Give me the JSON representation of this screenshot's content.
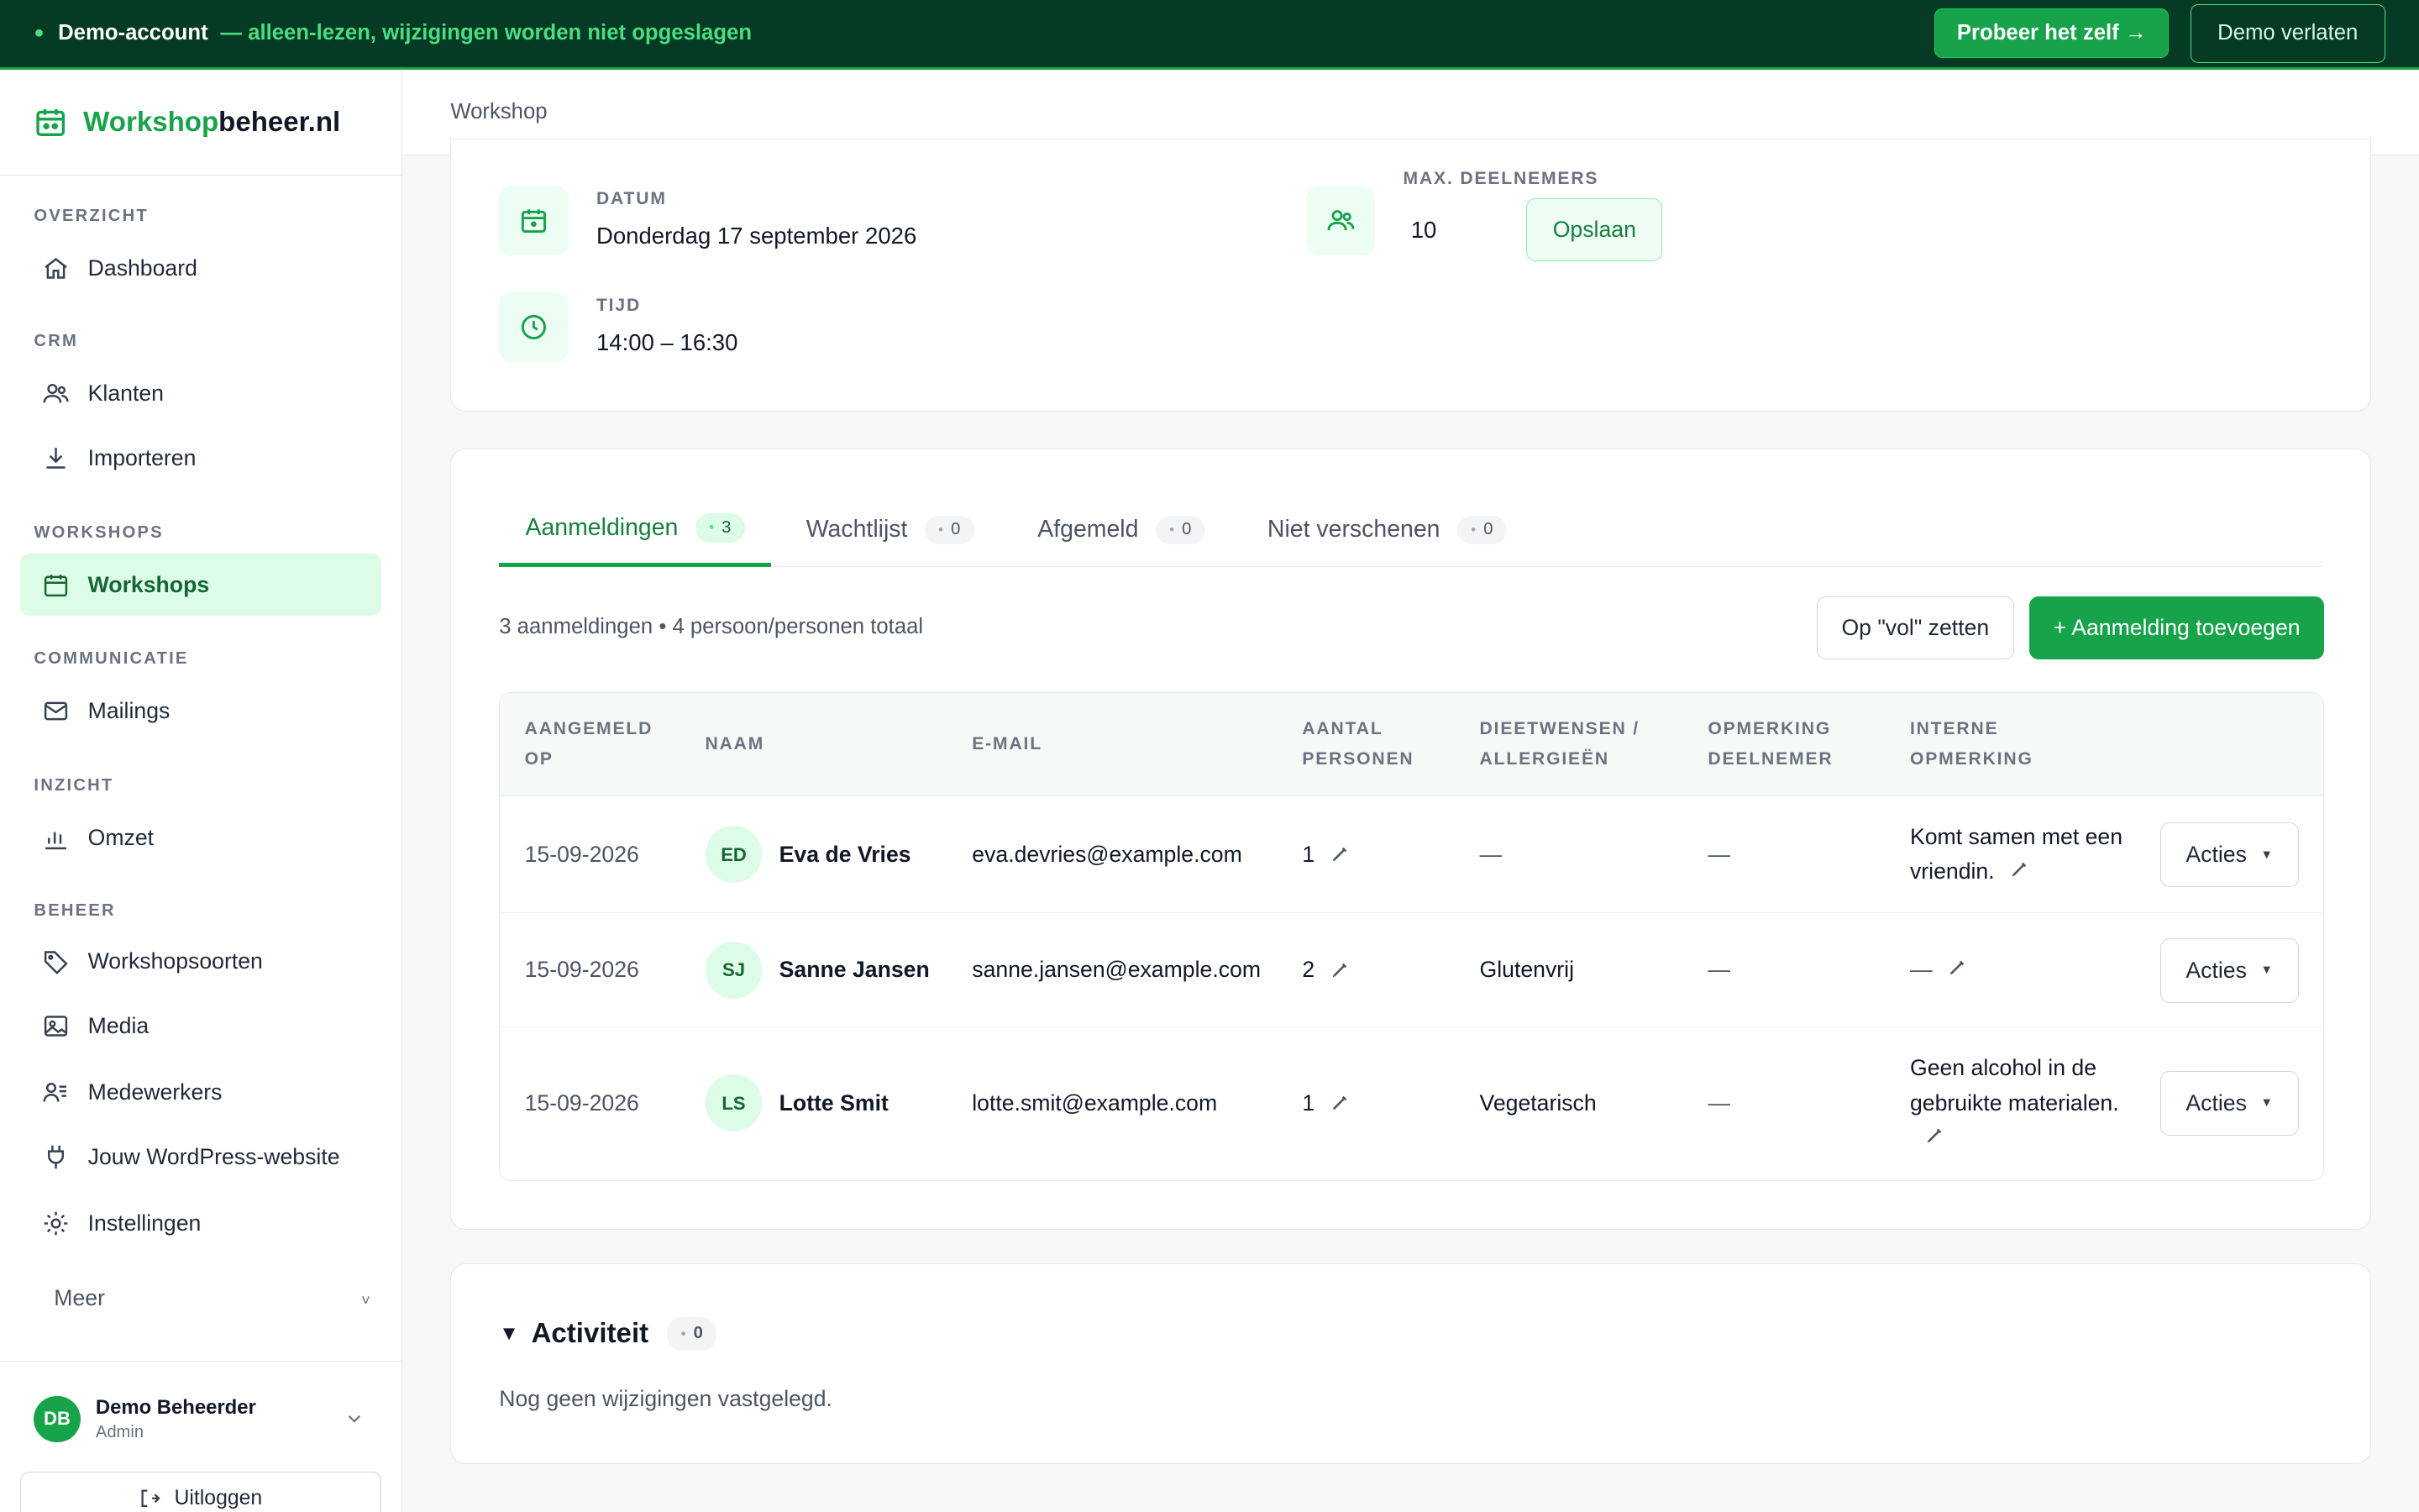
{
  "banner": {
    "title": "Demo-account",
    "subtitle": "— alleen-lezen, wijzigingen worden niet opgeslagen",
    "try_label": "Probeer het zelf →",
    "leave_label": "Demo verlaten"
  },
  "logo": {
    "part1": "Workshop",
    "part2": "beheer.nl"
  },
  "sidebar": {
    "sections": {
      "overzicht": "OVERZICHT",
      "crm": "CRM",
      "workshops": "WORKSHOPS",
      "communicatie": "COMMUNICATIE",
      "inzicht": "INZICHT",
      "beheer": "BEHEER"
    },
    "items": {
      "dashboard": "Dashboard",
      "klanten": "Klanten",
      "importeren": "Importeren",
      "workshops": "Workshops",
      "mailings": "Mailings",
      "omzet": "Omzet",
      "workshopsoorten": "Workshopsoorten",
      "media": "Media",
      "medewerkers": "Medewerkers",
      "wordpress": "Jouw WordPress-website",
      "instellingen": "Instellingen"
    },
    "more_label": "Meer",
    "more_chevron": "˅",
    "user": {
      "initials": "DB",
      "name": "Demo Beheerder",
      "role": "Admin"
    },
    "logout_label": "Uitloggen"
  },
  "topbar": {
    "breadcrumb": "Workshop"
  },
  "details": {
    "date_label": "DATUM",
    "date_value": "Donderdag 17 september 2026",
    "time_label": "TIJD",
    "time_value": "14:00 – 16:30",
    "max_label": "MAX. DEELNEMERS",
    "max_value": "10",
    "save_label": "Opslaan"
  },
  "tabs": [
    {
      "label": "Aanmeldingen",
      "count": "3"
    },
    {
      "label": "Wachtlijst",
      "count": "0"
    },
    {
      "label": "Afgemeld",
      "count": "0"
    },
    {
      "label": "Niet verschenen",
      "count": "0"
    }
  ],
  "pill_dot": "•",
  "registrations": {
    "summary": "3 aanmeldingen • 4 persoon/personen totaal",
    "full_label": "Op \"vol\" zetten",
    "add_label": "+ Aanmelding toevoegen",
    "columns": {
      "aangemeld_1": "AANGEMELD",
      "aangemeld_2": "OP",
      "naam": "NAAM",
      "email": "E-MAIL",
      "aantal_1": "AANTAL",
      "aantal_2": "PERSONEN",
      "dieet_1": "DIEETWENSEN /",
      "dieet_2": "ALLERGIEËN",
      "opm_1": "OPMERKING",
      "opm_2": "DEELNEMER",
      "intern_1": "INTERNE",
      "intern_2": "OPMERKING"
    },
    "actions_label": "Acties",
    "actions_caret": "▼",
    "rows": [
      {
        "date": "15-09-2026",
        "initials": "ED",
        "name": "Eva de Vries",
        "email": "eva.devries@example.com",
        "count": "1",
        "diet": "—",
        "remark": "—",
        "internal": "Komt samen met een vriendin."
      },
      {
        "date": "15-09-2026",
        "initials": "SJ",
        "name": "Sanne Jansen",
        "email": "sanne.jansen@example.com",
        "count": "2",
        "diet": "Glutenvrij",
        "remark": "—",
        "internal": "—"
      },
      {
        "date": "15-09-2026",
        "initials": "LS",
        "name": "Lotte Smit",
        "email": "lotte.smit@example.com",
        "count": "1",
        "diet": "Vegetarisch",
        "remark": "—",
        "internal": "Geen alcohol in de gebruikte materialen."
      }
    ]
  },
  "activity": {
    "toggle": "▼",
    "title": "Activiteit",
    "count": "0",
    "empty": "Nog geen wijzigingen vastgelegd."
  },
  "colors": {
    "accent": "#16a34a",
    "banner_bg": "#053a25",
    "accent_light": "#dcfce7"
  },
  "icons": {
    "banner": "eye-icon",
    "logo": "calendar-icon",
    "dashboard": "home-icon",
    "klanten": "users-icon",
    "importeren": "download-icon",
    "workshops": "calendar-icon",
    "mailings": "mail-icon",
    "omzet": "bar-chart-icon",
    "workshopsoorten": "tag-icon",
    "media": "image-icon",
    "medewerkers": "staff-icon",
    "wordpress": "plug-icon",
    "instellingen": "sun-gear-icon",
    "edit": "pencil-icon",
    "logout": "logout-icon"
  }
}
